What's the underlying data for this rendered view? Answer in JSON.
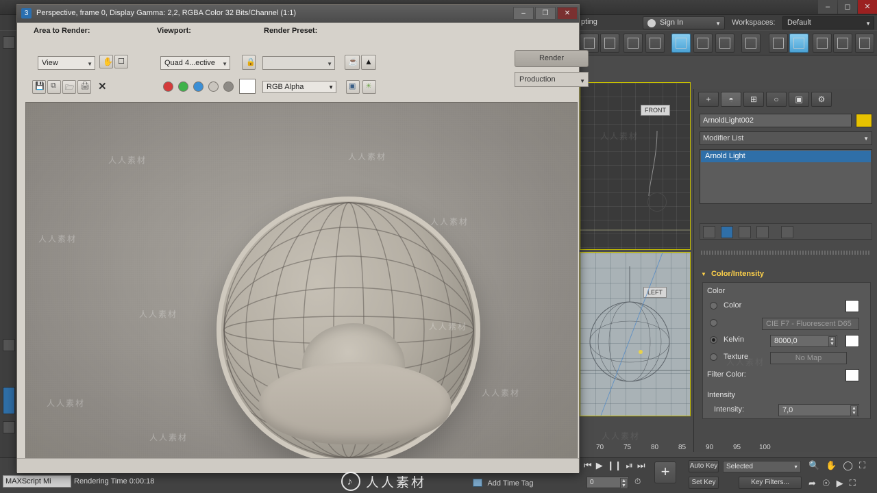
{
  "app": {
    "title_bar_buttons": [
      "minimize",
      "maximize",
      "close"
    ],
    "menu_visible_fragment": "pting",
    "signin_label": "Sign In",
    "workspaces_label": "Workspaces:",
    "workspace_value": "Default"
  },
  "render_window": {
    "title": "Perspective, frame 0, Display Gamma: 2,2, RGBA Color 32 Bits/Channel (1:1)",
    "window_icon_label": "3",
    "buttons": {
      "minimize": "–",
      "maximize": "❐",
      "close": "✕"
    },
    "area_to_render_label": "Area to Render:",
    "area_to_render_value": "View",
    "viewport_label": "Viewport:",
    "viewport_value": "Quad 4...ective",
    "render_preset_label": "Render Preset:",
    "render_preset_value": "",
    "render_button": "Render",
    "production_value": "Production",
    "channel_value": "RGB Alpha",
    "lock_icon": "lock",
    "status_text": "Rendering Time  0:00:18",
    "toolbar_icons": [
      "save-image",
      "copy-image",
      "clone-image",
      "print-image",
      "clear-image",
      "red-channel",
      "green-channel",
      "blue-channel",
      "alpha-channel",
      "mono-channel",
      "enable-red",
      "enable-green",
      "enable-blue",
      "enable-alpha",
      "toggle-ui",
      "color-correction"
    ]
  },
  "command_panel": {
    "tabs": [
      "create",
      "modify",
      "hierarchy",
      "motion",
      "display",
      "utilities"
    ],
    "object_name": "ArnoldLight002",
    "object_color": "#e7c200",
    "modifier_list_label": "Modifier List",
    "stack_items": [
      "Arnold Light"
    ],
    "rollout_title": "Color/Intensity",
    "color_group_label": "Color",
    "options": [
      {
        "name": "Color",
        "selected": false,
        "value": "",
        "swatch": "#ffffff"
      },
      {
        "name": "",
        "selected": false,
        "value": "CIE F7 - Fluorescent D65",
        "swatch": ""
      },
      {
        "name": "Kelvin",
        "selected": true,
        "value": "8000,0",
        "swatch": "#ffffff"
      },
      {
        "name": "Texture",
        "selected": false,
        "value": "No Map",
        "swatch": ""
      }
    ],
    "filter_color_label": "Filter Color:",
    "filter_color_swatch": "#ffffff",
    "intensity_group_label": "Intensity",
    "intensity_label": "Intensity:",
    "intensity_value": "7,0"
  },
  "viewports": {
    "top_label": "FRONT",
    "bottom_label": "LEFT"
  },
  "timeline": {
    "ticks": [
      "70",
      "75",
      "80",
      "85",
      "90",
      "95",
      "100"
    ],
    "frame_value": "0"
  },
  "status_bar": {
    "maxscript_label": "MAXScript Mi",
    "add_time_tag": "Add Time Tag",
    "auto_key": "Auto Key",
    "set_key": "Set Key",
    "selected": "Selected",
    "key_filters": "Key Filters..."
  },
  "watermark": {
    "text": "人人素材",
    "brand": "人人素材"
  }
}
